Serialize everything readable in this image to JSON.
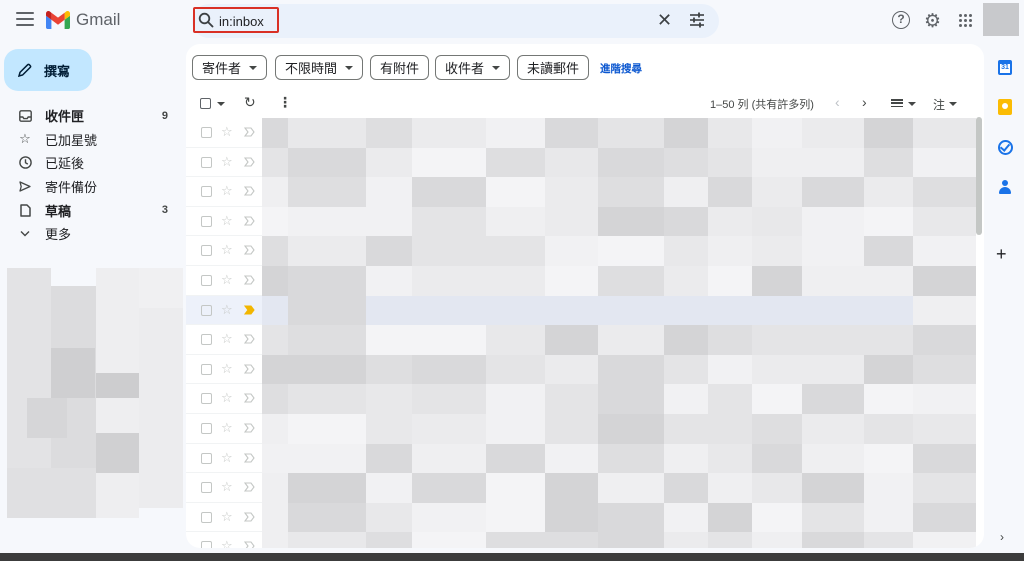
{
  "app": {
    "name": "Gmail"
  },
  "search": {
    "value": "in:inbox"
  },
  "compose": {
    "label": "撰寫"
  },
  "sidebar": {
    "items": [
      {
        "label": "收件匣",
        "count": "9",
        "icon": "inbox-icon",
        "bold": true
      },
      {
        "label": "已加星號",
        "count": "",
        "icon": "star-icon",
        "bold": false
      },
      {
        "label": "已延後",
        "count": "",
        "icon": "clock-icon",
        "bold": false
      },
      {
        "label": "寄件備份",
        "count": "",
        "icon": "send-icon",
        "bold": false
      },
      {
        "label": "草稿",
        "count": "3",
        "icon": "draft-icon",
        "bold": true
      },
      {
        "label": "更多",
        "count": "",
        "icon": "chevron-down-icon",
        "bold": false
      }
    ]
  },
  "filters": {
    "chips": [
      {
        "label": "寄件者",
        "dropdown": true
      },
      {
        "label": "不限時間",
        "dropdown": true
      },
      {
        "label": "有附件",
        "dropdown": false
      },
      {
        "label": "收件者",
        "dropdown": true
      },
      {
        "label": "未讀郵件",
        "dropdown": false
      }
    ],
    "advanced_search": "進階搜尋"
  },
  "toolbar": {
    "pagination": "1–50 列 (共有許多列)",
    "input_tool": "注"
  },
  "rows": {
    "selected_row": 6,
    "important_row": 6,
    "count": 15
  },
  "colors": {
    "accent": "#0b57d0",
    "compose_bg": "#c2e7ff",
    "search_bg": "#eaf1fb",
    "search_highlight": "#d93025",
    "important_marker": "#f2b600"
  }
}
